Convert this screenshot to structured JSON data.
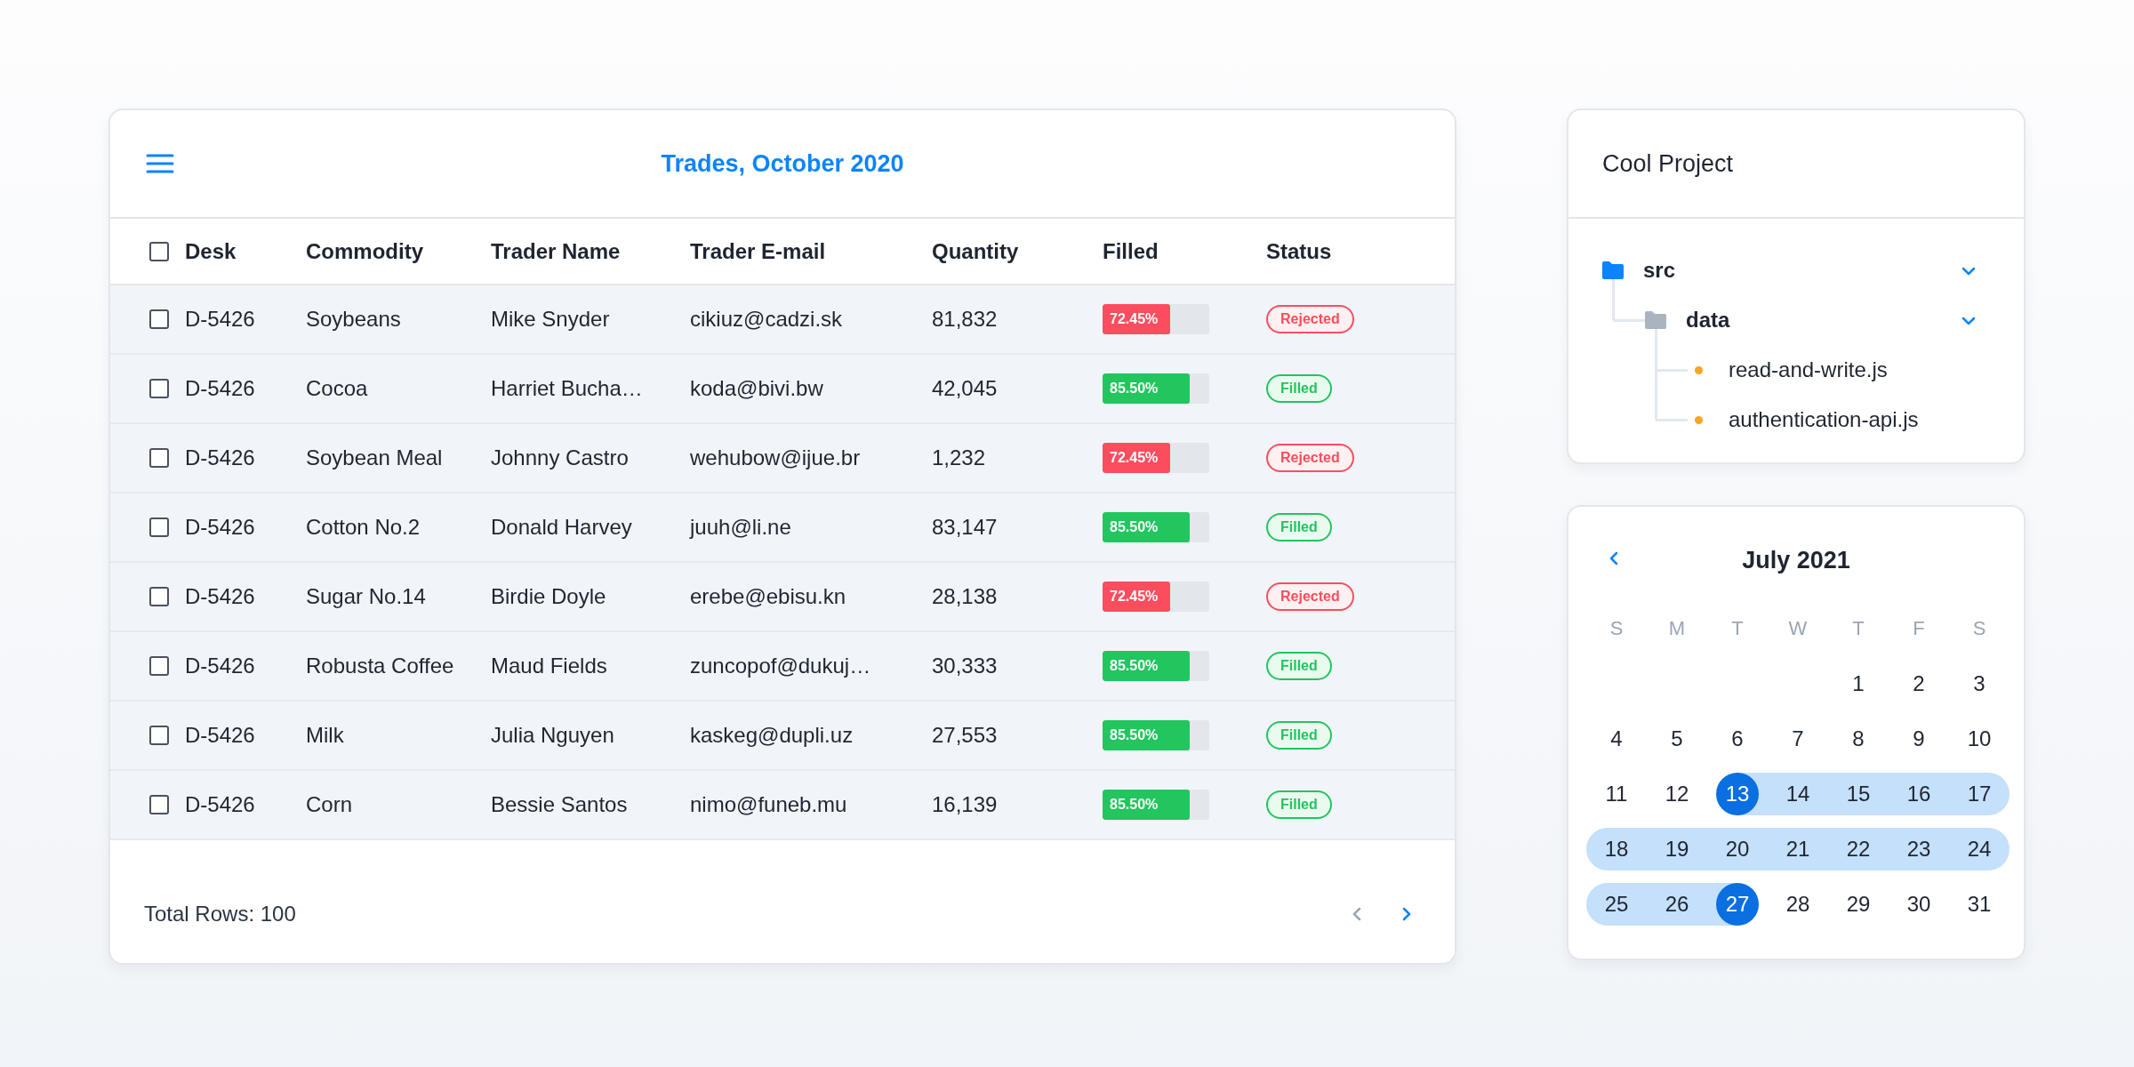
{
  "table": {
    "title": "Trades, October 2020",
    "select_all": {
      "checked": false
    },
    "columns": [
      "Desk",
      "Commodity",
      "Trader Name",
      "Trader E-mail",
      "Quantity",
      "Filled",
      "Status"
    ],
    "rows": [
      {
        "checked": false,
        "desk": "D-5426",
        "commodity": "Soybeans",
        "trader_name": "Mike Snyder",
        "trader_email": "cikiuz@cadzi.sk",
        "quantity": "81,832",
        "filled": {
          "label": "72.45%",
          "level": 0.63
        },
        "status": {
          "label": "Rejected",
          "kind": "rejected"
        }
      },
      {
        "checked": false,
        "desk": "D-5426",
        "commodity": "Cocoa",
        "trader_name": "Harriet Bucha…",
        "trader_email": "koda@bivi.bw",
        "quantity": "42,045",
        "filled": {
          "label": "85.50%",
          "level": 0.82
        },
        "status": {
          "label": "Filled",
          "kind": "filled"
        }
      },
      {
        "checked": false,
        "desk": "D-5426",
        "commodity": "Soybean Meal",
        "trader_name": "Johnny Castro",
        "trader_email": "wehubow@ijue.br",
        "quantity": "1,232",
        "filled": {
          "label": "72.45%",
          "level": 0.63
        },
        "status": {
          "label": "Rejected",
          "kind": "rejected"
        }
      },
      {
        "checked": false,
        "desk": "D-5426",
        "commodity": "Cotton No.2",
        "trader_name": "Donald Harvey",
        "trader_email": "juuh@li.ne",
        "quantity": "83,147",
        "filled": {
          "label": "85.50%",
          "level": 0.82
        },
        "status": {
          "label": "Filled",
          "kind": "filled"
        }
      },
      {
        "checked": false,
        "desk": "D-5426",
        "commodity": "Sugar No.14",
        "trader_name": "Birdie Doyle",
        "trader_email": "erebe@ebisu.kn",
        "quantity": "28,138",
        "filled": {
          "label": "72.45%",
          "level": 0.63
        },
        "status": {
          "label": "Rejected",
          "kind": "rejected"
        }
      },
      {
        "checked": false,
        "desk": "D-5426",
        "commodity": "Robusta Coffee",
        "trader_name": "Maud Fields",
        "trader_email": "zuncopof@dukuj…",
        "quantity": "30,333",
        "filled": {
          "label": "85.50%",
          "level": 0.82
        },
        "status": {
          "label": "Filled",
          "kind": "filled"
        }
      },
      {
        "checked": false,
        "desk": "D-5426",
        "commodity": "Milk",
        "trader_name": "Julia Nguyen",
        "trader_email": "kaskeg@dupli.uz",
        "quantity": "27,553",
        "filled": {
          "label": "85.50%",
          "level": 0.82
        },
        "status": {
          "label": "Filled",
          "kind": "filled"
        }
      },
      {
        "checked": false,
        "desk": "D-5426",
        "commodity": "Corn",
        "trader_name": "Bessie Santos",
        "trader_email": "nimo@funeb.mu",
        "quantity": "16,139",
        "filled": {
          "label": "85.50%",
          "level": 0.82
        },
        "status": {
          "label": "Filled",
          "kind": "filled"
        }
      }
    ],
    "footer": {
      "total": "Total Rows: 100",
      "prev": {
        "disabled": true
      },
      "next": {
        "disabled": false
      }
    }
  },
  "project": {
    "title": "Cool Project",
    "tree": [
      {
        "kind": "folder",
        "name": "src",
        "color": "#0a84ff",
        "expanded": true,
        "children": [
          {
            "kind": "folder",
            "name": "data",
            "color": "#aab4c0",
            "expanded": true,
            "children": [
              {
                "kind": "file",
                "name": "read-and-write.js",
                "color": "#f5a524"
              },
              {
                "kind": "file",
                "name": "authentication-api.js",
                "color": "#f5a524"
              }
            ]
          }
        ]
      }
    ]
  },
  "calendar": {
    "title": "July 2021",
    "weekdays": [
      "S",
      "M",
      "T",
      "W",
      "T",
      "F",
      "S"
    ],
    "weeks": [
      [
        {
          "label": "1",
          "selected": false,
          "in_range": false
        },
        {
          "label": "2",
          "selected": false,
          "in_range": false
        },
        {
          "label": "3",
          "selected": false,
          "in_range": false
        }
      ],
      [
        {
          "label": "4",
          "selected": false,
          "in_range": false
        },
        {
          "label": "5",
          "selected": false,
          "in_range": false
        },
        {
          "label": "6",
          "selected": false,
          "in_range": false
        },
        {
          "label": "7",
          "selected": false,
          "in_range": false
        },
        {
          "label": "8",
          "selected": false,
          "in_range": false
        },
        {
          "label": "9",
          "selected": false,
          "in_range": false
        },
        {
          "label": "10",
          "selected": false,
          "in_range": false
        }
      ],
      [
        {
          "label": "11",
          "selected": false,
          "in_range": false
        },
        {
          "label": "12",
          "selected": false,
          "in_range": false
        },
        {
          "label": "13",
          "selected": true,
          "in_range": true
        },
        {
          "label": "14",
          "selected": false,
          "in_range": true
        },
        {
          "label": "15",
          "selected": false,
          "in_range": true
        },
        {
          "label": "16",
          "selected": false,
          "in_range": true
        },
        {
          "label": "17",
          "selected": false,
          "in_range": true
        }
      ],
      [
        {
          "label": "18",
          "selected": false,
          "in_range": true
        },
        {
          "label": "19",
          "selected": false,
          "in_range": true
        },
        {
          "label": "20",
          "selected": false,
          "in_range": true
        },
        {
          "label": "21",
          "selected": false,
          "in_range": true
        },
        {
          "label": "22",
          "selected": false,
          "in_range": true
        },
        {
          "label": "23",
          "selected": false,
          "in_range": true
        },
        {
          "label": "24",
          "selected": false,
          "in_range": true
        }
      ],
      [
        {
          "label": "25",
          "selected": false,
          "in_range": true
        },
        {
          "label": "26",
          "selected": false,
          "in_range": true
        },
        {
          "label": "27",
          "selected": true,
          "in_range": true
        },
        {
          "label": "28",
          "selected": false,
          "in_range": false
        },
        {
          "label": "29",
          "selected": false,
          "in_range": false
        },
        {
          "label": "30",
          "selected": false,
          "in_range": false
        },
        {
          "label": "31",
          "selected": false,
          "in_range": false
        }
      ]
    ]
  }
}
